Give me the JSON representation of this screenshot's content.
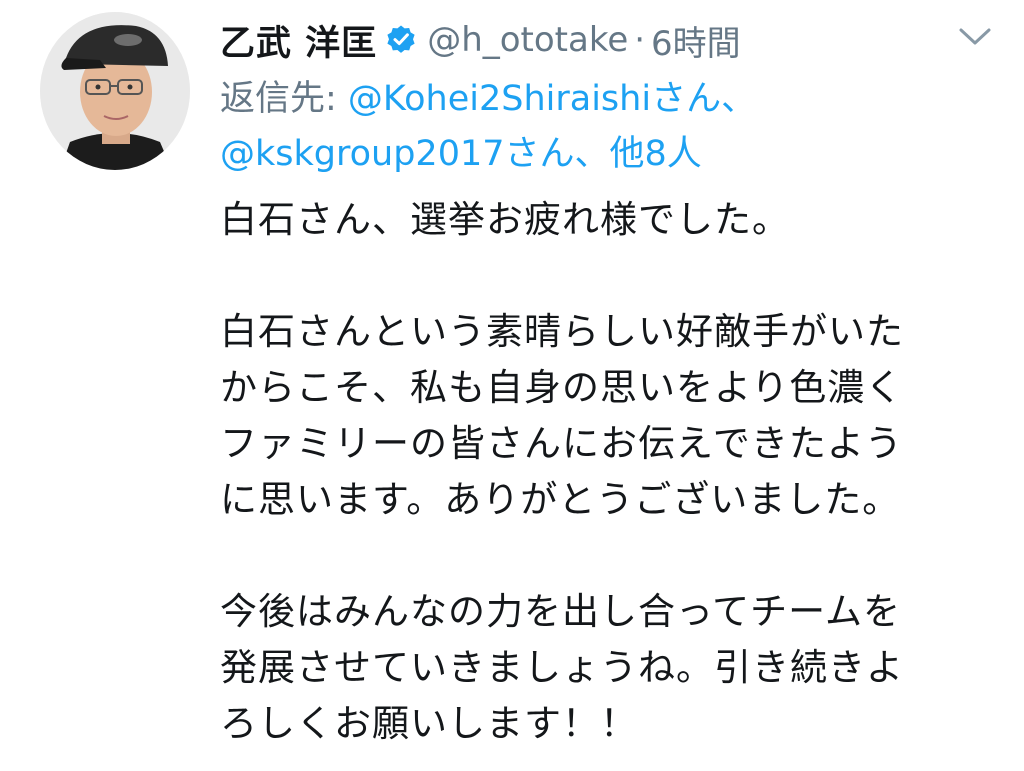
{
  "tweet": {
    "display_name": "乙武 洋匡",
    "handle": "@h_ototake",
    "separator": "·",
    "time": "6時間",
    "verified_icon": "verified-badge-icon",
    "menu_icon": "chevron-down-icon",
    "avatar_icon": "user-avatar",
    "reply_to": {
      "prefix": "返信先: ",
      "mention_1": "@Kohei2Shiraishi",
      "suffix_1": "さん、",
      "mention_2": "@kskgroup2017",
      "suffix_2": "さん、",
      "others": "他8人"
    },
    "body": {
      "para1": [
        "白石さん、選挙お疲れ様でした。"
      ],
      "para2": [
        "白石さんという素晴らしい好敵手がいた",
        "からこそ、私も自身の思いをより色濃く",
        "ファミリーの皆さんにお伝えできたよう",
        "に思います。ありがとうございました。"
      ],
      "para3": [
        "今後はみんなの力を出し合ってチームを",
        "発展させていきましょうね。引き続きよ",
        "ろしくお願いします！！"
      ]
    },
    "colors": {
      "link": "#1da1f2",
      "secondary": "#657786",
      "text": "#14171a"
    }
  }
}
